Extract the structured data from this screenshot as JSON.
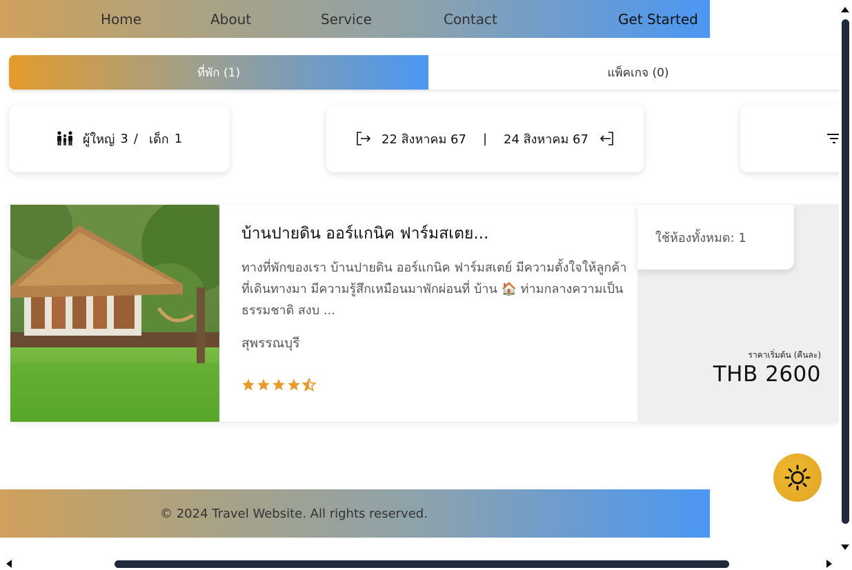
{
  "nav": {
    "links": [
      "Home",
      "About",
      "Service",
      "Contact"
    ],
    "cta": "Get Started"
  },
  "tabs": {
    "accommodation": "ที่พัก (1)",
    "package": "แพ็คเกจ (0)"
  },
  "search": {
    "adults_label": "ผู้ใหญ่",
    "adults": "3",
    "separator": "/",
    "children_label": "เด็ก",
    "children": "1",
    "checkin": "22 สิงหาคม 67",
    "date_divider": "|",
    "checkout": "24 สิงหาคม 67"
  },
  "result": {
    "name": "บ้านปายดิน ออร์แกนิค ฟาร์มสเตย...",
    "description": "ทางที่พักของเรา บ้านปายดิน ออร์แกนิค ฟาร์มสเตย์ มีความตั้งใจให้ลูกค้าที่เดินทางมา มีความรู้สึกเหมือนมาพักผ่อนที่ บ้าน 🏠 ท่ามกลางความเป็นธรรมชาติ สงบ ...",
    "location": "สุพรรณบุรี",
    "rating": 4.5,
    "rooms": "ใช้ห้องทั้งหมด: 1",
    "price_label": "ราคาเริ่มต้น (คืนละ)",
    "price": "THB 2600"
  },
  "footer": {
    "copyright": "© 2024 Travel Website. All rights reserved."
  },
  "colors": {
    "gradient_start": "#cfa15b",
    "gradient_end": "#4b97f3",
    "tab_start": "#e49b2c",
    "star": "#e49b2c",
    "theme_button": "#e8ab2a",
    "scrollbar": "#1f2a3a"
  },
  "icons": {
    "guests": "family-icon",
    "checkin": "login-arrow-icon",
    "checkout": "logout-arrow-icon",
    "sort": "filter-lines-icon",
    "theme": "sun-icon"
  }
}
